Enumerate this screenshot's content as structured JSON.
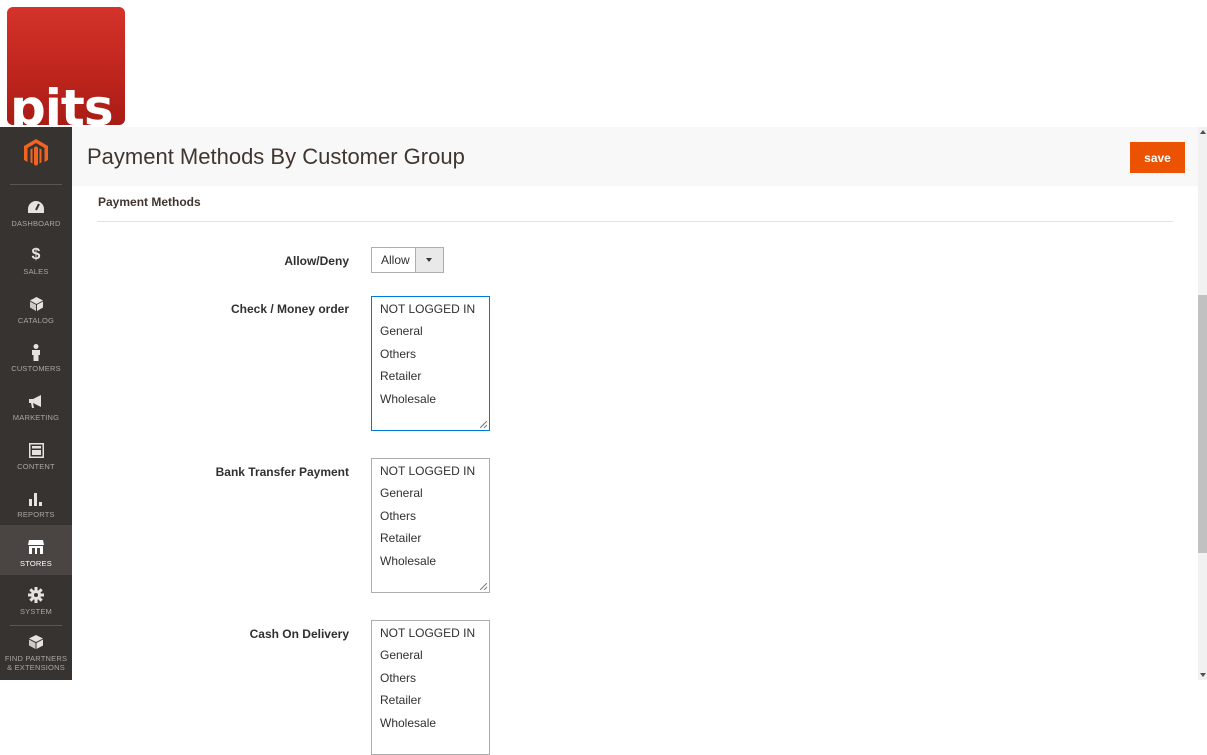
{
  "logo": {
    "text": "pits"
  },
  "sidebar": {
    "items": [
      {
        "label": "DASHBOARD",
        "icon": "dashboard-icon"
      },
      {
        "label": "SALES",
        "icon": "dollar-icon"
      },
      {
        "label": "CATALOG",
        "icon": "cube-icon"
      },
      {
        "label": "CUSTOMERS",
        "icon": "person-icon"
      },
      {
        "label": "MARKETING",
        "icon": "megaphone-icon"
      },
      {
        "label": "CONTENT",
        "icon": "layout-icon"
      },
      {
        "label": "REPORTS",
        "icon": "bar-chart-icon"
      },
      {
        "label": "STORES",
        "icon": "storefront-icon",
        "active": true
      },
      {
        "label": "SYSTEM",
        "icon": "gear-icon"
      },
      {
        "label": "FIND PARTNERS & EXTENSIONS",
        "icon": "box-icon"
      }
    ]
  },
  "header": {
    "title": "Payment Methods By Customer Group",
    "save_label": "save"
  },
  "section": {
    "title": "Payment Methods"
  },
  "fields": {
    "allow_deny": {
      "label": "Allow/Deny",
      "value": "Allow"
    },
    "check_money_order": {
      "label": "Check / Money order",
      "options": [
        "NOT LOGGED IN",
        "General",
        "Others",
        "Retailer",
        "Wholesale"
      ]
    },
    "bank_transfer": {
      "label": "Bank Transfer Payment",
      "options": [
        "NOT LOGGED IN",
        "General",
        "Others",
        "Retailer",
        "Wholesale"
      ]
    },
    "cash_on_delivery": {
      "label": "Cash On Delivery",
      "options": [
        "NOT LOGGED IN",
        "General",
        "Others",
        "Retailer",
        "Wholesale"
      ]
    }
  },
  "colors": {
    "accent": "#eb5202",
    "sidebar_bg": "#373330",
    "logo_red": "#c4271f",
    "magento_orange": "#f26322"
  }
}
